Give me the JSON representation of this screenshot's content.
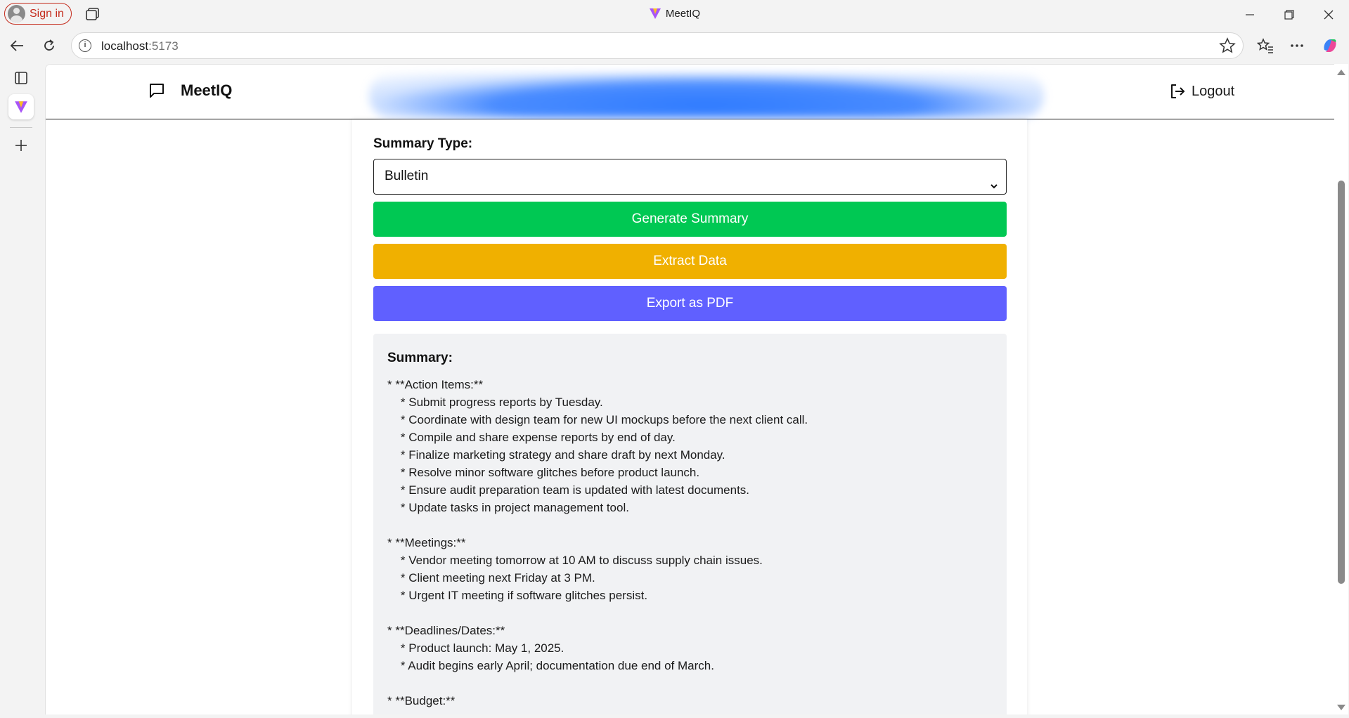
{
  "browser": {
    "window_title": "MeetIQ",
    "sign_in_label": "Sign in",
    "url_host": "localhost",
    "url_port": ":5173"
  },
  "app": {
    "brand": "MeetIQ",
    "logout_label": "Logout"
  },
  "form": {
    "summary_type_label": "Summary Type:",
    "summary_type_value": "Bulletin",
    "generate_label": "Generate Summary",
    "extract_label": "Extract Data",
    "export_label": "Export as PDF"
  },
  "summary": {
    "title": "Summary:",
    "text": "* **Action Items:**\n    * Submit progress reports by Tuesday.\n    * Coordinate with design team for new UI mockups before the next client call.\n    * Compile and share expense reports by end of day.\n    * Finalize marketing strategy and share draft by next Monday.\n    * Resolve minor software glitches before product launch.\n    * Ensure audit preparation team is updated with latest documents.\n    * Update tasks in project management tool.\n\n* **Meetings:**\n    * Vendor meeting tomorrow at 10 AM to discuss supply chain issues.\n    * Client meeting next Friday at 3 PM.\n    * Urgent IT meeting if software glitches persist.\n\n* **Deadlines/Dates:**\n    * Product launch: May 1, 2025.\n    * Audit begins early April; documentation due end of March.\n\n* **Budget:**"
  },
  "colors": {
    "generate": "#00c853",
    "extract": "#f0b000",
    "export": "#6060ff",
    "header_glow": "#2f7bff"
  }
}
